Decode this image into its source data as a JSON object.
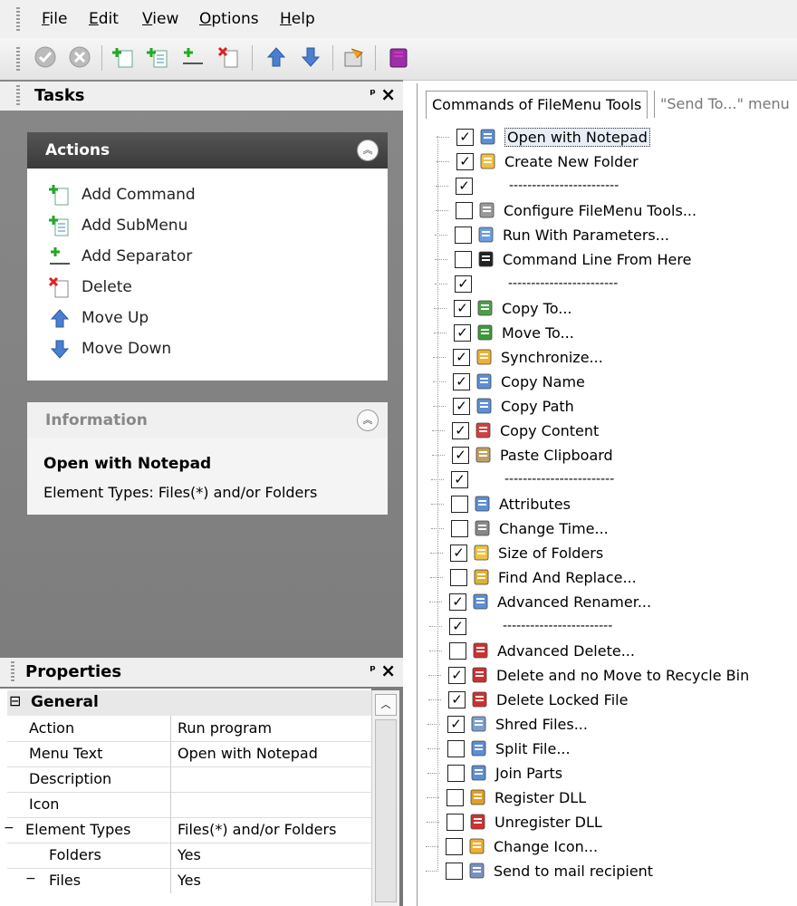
{
  "menu": [
    "File",
    "Edit",
    "View",
    "Options",
    "Help"
  ],
  "menu_accel": [
    "F",
    "E",
    "V",
    "O",
    "H"
  ],
  "tasks_panel": {
    "title": "Tasks",
    "pin": "📌",
    "close": "✕"
  },
  "actions": {
    "title": "Actions",
    "items": [
      {
        "label": "Add Command",
        "icon": "add-command-icon"
      },
      {
        "label": "Add SubMenu",
        "icon": "add-submenu-icon"
      },
      {
        "label": "Add Separator",
        "icon": "add-separator-icon"
      },
      {
        "label": "Delete",
        "icon": "delete-icon"
      },
      {
        "label": "Move Up",
        "icon": "arrow-up-icon"
      },
      {
        "label": "Move Down",
        "icon": "arrow-down-icon"
      }
    ]
  },
  "information": {
    "title": "Information",
    "name": "Open with Notepad",
    "detail": "Element Types: Files(*) and/or Folders"
  },
  "properties": {
    "title": "Properties",
    "section": "General",
    "rows": [
      {
        "key": "Action",
        "value": "Run program",
        "indent": 0
      },
      {
        "key": "Menu Text",
        "value": "Open with Notepad",
        "indent": 0
      },
      {
        "key": "Description",
        "value": "",
        "indent": 0
      },
      {
        "key": "Icon",
        "value": "",
        "indent": 0
      },
      {
        "key": "Element Types",
        "value": "Files(*) and/or Folders",
        "indent": 0,
        "expander": "−"
      },
      {
        "key": "Folders",
        "value": "Yes",
        "indent": 1
      },
      {
        "key": "Files",
        "value": "Yes",
        "indent": 1,
        "expander": "−"
      }
    ]
  },
  "tabs": [
    "Commands of FileMenu Tools",
    "\"Send To...\" menu"
  ],
  "tree": [
    {
      "label": "Open with Notepad",
      "checked": true,
      "icon": "notepad-icon",
      "selected": true
    },
    {
      "label": "Create New Folder",
      "checked": true,
      "icon": "folder-icon"
    },
    {
      "label": "------------------------",
      "checked": true,
      "icon": "",
      "sep": true
    },
    {
      "label": "Configure FileMenu Tools...",
      "checked": false,
      "icon": "tools-icon"
    },
    {
      "label": "Run With Parameters...",
      "checked": false,
      "icon": "run-icon"
    },
    {
      "label": "Command Line From Here",
      "checked": false,
      "icon": "console-icon"
    },
    {
      "label": "------------------------",
      "checked": true,
      "icon": "",
      "sep": true
    },
    {
      "label": "Copy To...",
      "checked": true,
      "icon": "copy-to-icon"
    },
    {
      "label": "Move To...",
      "checked": true,
      "icon": "move-to-icon"
    },
    {
      "label": "Synchronize...",
      "checked": true,
      "icon": "sync-icon"
    },
    {
      "label": "Copy Name",
      "checked": true,
      "icon": "copy-name-icon"
    },
    {
      "label": "Copy Path",
      "checked": true,
      "icon": "copy-path-icon"
    },
    {
      "label": "Copy Content",
      "checked": true,
      "icon": "copy-content-icon"
    },
    {
      "label": "Paste Clipboard",
      "checked": true,
      "icon": "paste-icon"
    },
    {
      "label": "------------------------",
      "checked": true,
      "icon": "",
      "sep": true
    },
    {
      "label": "Attributes",
      "checked": false,
      "icon": "attributes-icon"
    },
    {
      "label": "Change Time...",
      "checked": false,
      "icon": "time-icon"
    },
    {
      "label": "Size of Folders",
      "checked": true,
      "icon": "folder-size-icon"
    },
    {
      "label": "Find And Replace...",
      "checked": false,
      "icon": "find-replace-icon"
    },
    {
      "label": "Advanced Renamer...",
      "checked": true,
      "icon": "rename-icon"
    },
    {
      "label": "------------------------",
      "checked": true,
      "icon": "",
      "sep": true
    },
    {
      "label": "Advanced Delete...",
      "checked": false,
      "icon": "adv-delete-icon"
    },
    {
      "label": "Delete and no Move to Recycle Bin",
      "checked": true,
      "icon": "delete-no-recycle-icon"
    },
    {
      "label": "Delete Locked File",
      "checked": true,
      "icon": "delete-locked-icon"
    },
    {
      "label": "Shred Files...",
      "checked": true,
      "icon": "shred-icon"
    },
    {
      "label": "Split File...",
      "checked": false,
      "icon": "split-icon"
    },
    {
      "label": "Join Parts",
      "checked": false,
      "icon": "join-icon"
    },
    {
      "label": "Register DLL",
      "checked": false,
      "icon": "register-dll-icon"
    },
    {
      "label": "Unregister DLL",
      "checked": false,
      "icon": "unregister-dll-icon"
    },
    {
      "label": "Change Icon...",
      "checked": false,
      "icon": "change-icon-icon"
    },
    {
      "label": "Send to mail recipient",
      "checked": false,
      "icon": "mail-icon"
    }
  ]
}
